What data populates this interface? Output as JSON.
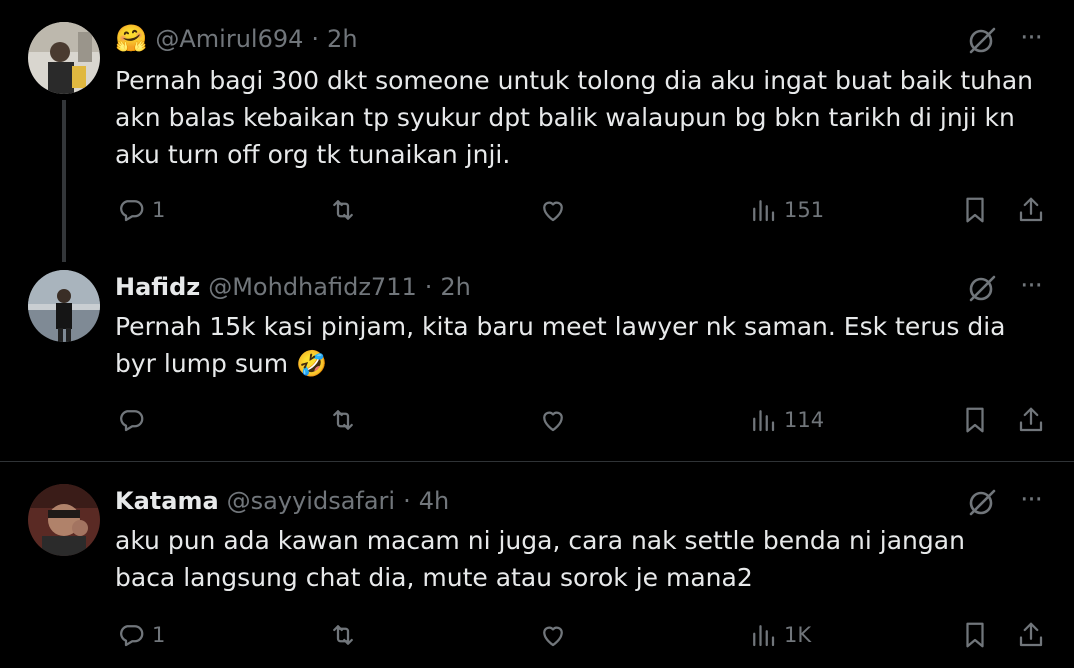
{
  "tweets": [
    {
      "name_emoji": "🤗",
      "display_name": "",
      "handle": "@Amirul694",
      "dot": "·",
      "time": "2h",
      "text": "Pernah bagi 300 dkt someone untuk tolong dia aku ingat buat baik tuhan akn balas kebaikan tp syukur dpt balik walaupun bg bkn tarikh di jnji kn aku turn off org tk tunaikan jnji.",
      "replies": "1",
      "reposts": "",
      "likes": "",
      "views": "151"
    },
    {
      "name_emoji": "",
      "display_name": "Hafidz",
      "handle": "@Mohdhafidz711",
      "dot": "·",
      "time": "2h",
      "text": "Pernah 15k kasi pinjam, kita baru meet lawyer nk saman. Esk terus dia byr lump sum 🤣",
      "replies": "",
      "reposts": "",
      "likes": "",
      "views": "114"
    },
    {
      "name_emoji": "",
      "display_name": "Katama",
      "handle": "@sayyidsafari",
      "dot": "·",
      "time": "4h",
      "text": "aku pun ada kawan macam ni juga, cara nak settle benda ni jangan baca langsung chat dia, mute atau sorok je mana2",
      "replies": "1",
      "reposts": "",
      "likes": "",
      "views": "1K"
    }
  ],
  "icons": {
    "reply": "reply-icon",
    "repost": "repost-icon",
    "like": "like-icon",
    "views": "views-icon",
    "bookmark": "bookmark-icon",
    "share": "share-icon",
    "grok": "grok-icon",
    "more": "more-icon"
  },
  "colors": {
    "background": "#000000",
    "text": "#e7e9ea",
    "muted": "#71767b",
    "divider": "#2f3336"
  }
}
